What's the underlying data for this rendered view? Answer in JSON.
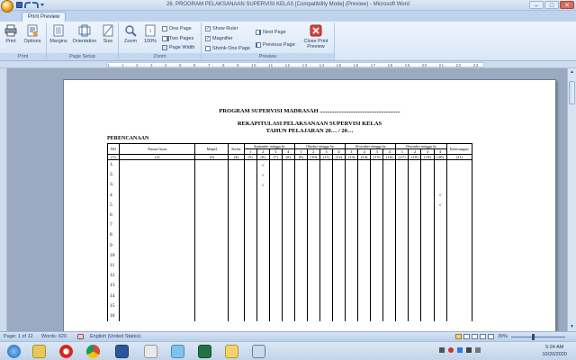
{
  "window": {
    "title": "26. PROGRAM PELAKSANAAN SUPERVISI KELAS [Compatibility Mode] (Preview) - Microsoft Word",
    "minimize": "–",
    "maximize": "□",
    "close": "✕"
  },
  "ribbon": {
    "active_tab": "Print Preview",
    "groups": {
      "print": {
        "label": "Print",
        "print": "Print",
        "options": "Options"
      },
      "page_setup": {
        "label": "Page Setup",
        "margins": "Margins",
        "orientation": "Orientation",
        "size": "Size"
      },
      "zoom": {
        "label": "Zoom",
        "zoom": "Zoom",
        "hundred": "100%",
        "one_page": "One Page",
        "two_pages": "Two Pages",
        "page_width": "Page Width"
      },
      "preview": {
        "label": "Preview",
        "show_ruler": "Show Ruler",
        "magnifier": "Magnifier",
        "shrink_one_page": "Shrink One Page",
        "next_page": "Next Page",
        "previous_page": "Previous Page",
        "close_line1": "Close Print",
        "close_line2": "Preview"
      }
    }
  },
  "ruler_ticks": "1 · · · 1 · · · 2 · · · 3 · · · 4 · · · 5 · · · 6 · · · 7 · · · 8 · · · 9 · · · 10 · · · 11 · · · 12 · · · 13 · · · 14 · · · 15 · · · 16 · · · 17 · · · 18 · · · 19 · · · 20 · · · 21 · · · 22 · · · 23 · · · 24 · · · 25 · · · 26 · · · 27 · · · 28 · · · 29",
  "document": {
    "title": "PROGRAM SUPERVISI MADRASAH .......................................................",
    "subtitle1": "REKAPITULASI PELAKSANAAN SUPERVISI KELAS",
    "subtitle2": "TAHUN PELAJARAN 20… / 20…",
    "section": "PERENCANAAN",
    "headers": {
      "no": "NO",
      "nama_guru": "Nama Guru",
      "mapel": "Mapel",
      "kelas": "Kelas",
      "keterangan": "Keterangan"
    },
    "months": [
      "September minggu ke",
      "Oktober minggu ke",
      "November minggu ke",
      "Desember minggu ke"
    ],
    "weeks": [
      "1",
      "2",
      "3",
      "4"
    ],
    "column_numbers": [
      "(1)",
      "(2)",
      "(3)",
      "(4)",
      "(5)",
      "(6)",
      "(7)",
      "(8)",
      "(9)",
      "(10)",
      "(11)",
      "(12)",
      "(13)",
      "(14)",
      "(15)",
      "(16)",
      "(17)",
      "(18)",
      "(19)",
      "(20)",
      "(21)"
    ],
    "row_numbers": [
      "1.",
      "2.",
      "3.",
      "4",
      "5",
      "6",
      "7",
      "8",
      "9",
      "10",
      "11",
      "12",
      "13",
      "14",
      "15",
      "16"
    ],
    "checkmarks": {
      "1": "6",
      "2": "6",
      "3": "6",
      "4": "20",
      "5": "20"
    },
    "check_symbol": "√"
  },
  "status": {
    "page": "Page: 1 of 12",
    "words": "Words: 620",
    "language": "English (United States)",
    "zoom": "39%"
  },
  "taskbar": {
    "time": "5:24 AM",
    "date": "10/20/2020"
  },
  "colors": {
    "ribbon_bg": "#d9e6f6",
    "workspace": "#9baac0",
    "taskbar": "#c2d4ea"
  }
}
